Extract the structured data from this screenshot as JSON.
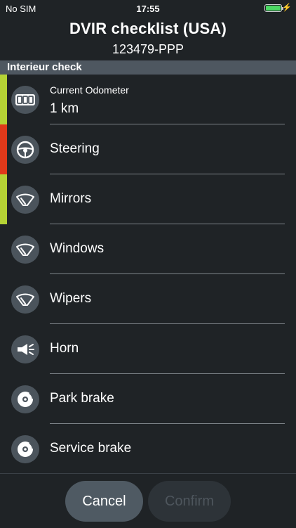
{
  "status": {
    "carrier": "No SIM",
    "time": "17:55",
    "battery_color": "#4cd964"
  },
  "header": {
    "title": "DVIR checklist (USA)",
    "subtitle": "123479-PPP"
  },
  "section": {
    "title": "Interieur check"
  },
  "items": [
    {
      "label": "Current Odometer",
      "value": "1 km",
      "icon": "odometer-icon",
      "status": "ok",
      "status_color": "#b5d335"
    },
    {
      "label": "Steering",
      "icon": "steering-wheel-icon",
      "status": "defect",
      "status_color": "#e0391a"
    },
    {
      "label": "Mirrors",
      "icon": "wiper-icon",
      "status": "ok",
      "status_color": "#b5d335"
    },
    {
      "label": "Windows",
      "icon": "wiper-icon"
    },
    {
      "label": "Wipers",
      "icon": "wiper-icon"
    },
    {
      "label": "Horn",
      "icon": "horn-icon"
    },
    {
      "label": "Park brake",
      "icon": "brake-disc-icon"
    },
    {
      "label": "Service brake",
      "icon": "brake-disc-icon"
    }
  ],
  "buttons": {
    "cancel": "Cancel",
    "confirm": "Confirm"
  }
}
